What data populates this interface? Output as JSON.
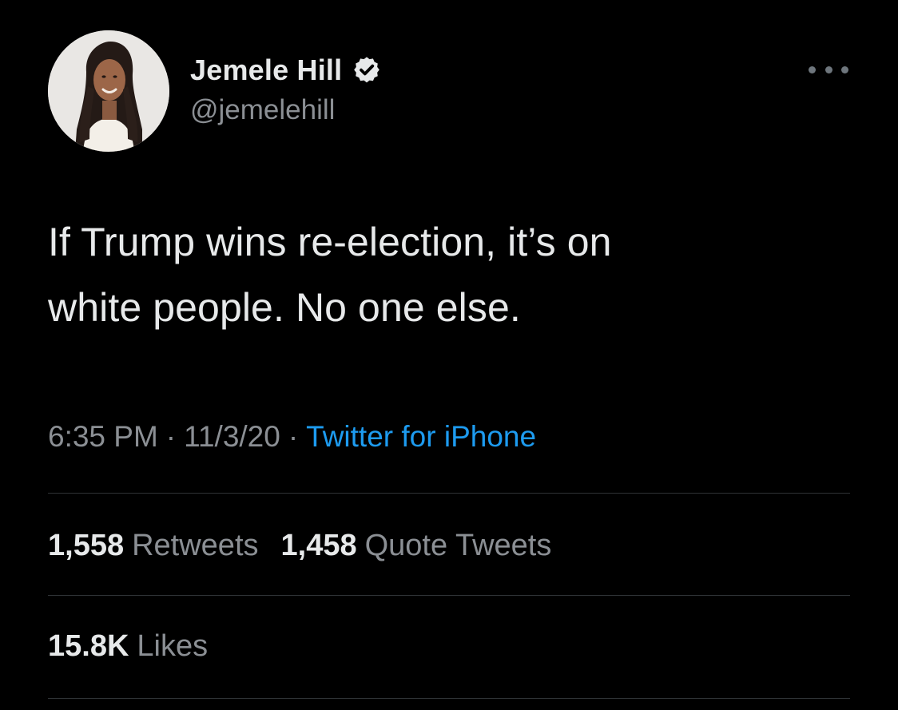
{
  "user": {
    "display_name": "Jemele Hill",
    "handle": "@jemelehill",
    "verified": true,
    "avatar_icon": "profile-photo"
  },
  "tweet": {
    "text_line1": "If Trump wins re-election, it’s on",
    "text_line2": "white people. No one else.",
    "time": "6:35 PM",
    "separator": "·",
    "date": "11/3/20",
    "source": "Twitter for iPhone"
  },
  "stats": {
    "retweets_count": "1,558",
    "retweets_label": "Retweets",
    "quotes_count": "1,458",
    "quotes_label": "Quote Tweets",
    "likes_count": "15.8K",
    "likes_label": "Likes"
  },
  "colors": {
    "background": "#000000",
    "text": "#e7e9ea",
    "secondary": "#8b8f94",
    "link": "#1d9bf0",
    "divider": "#2f3336"
  },
  "icons": {
    "verified": "verified-badge-icon",
    "more": "more-options-icon"
  }
}
